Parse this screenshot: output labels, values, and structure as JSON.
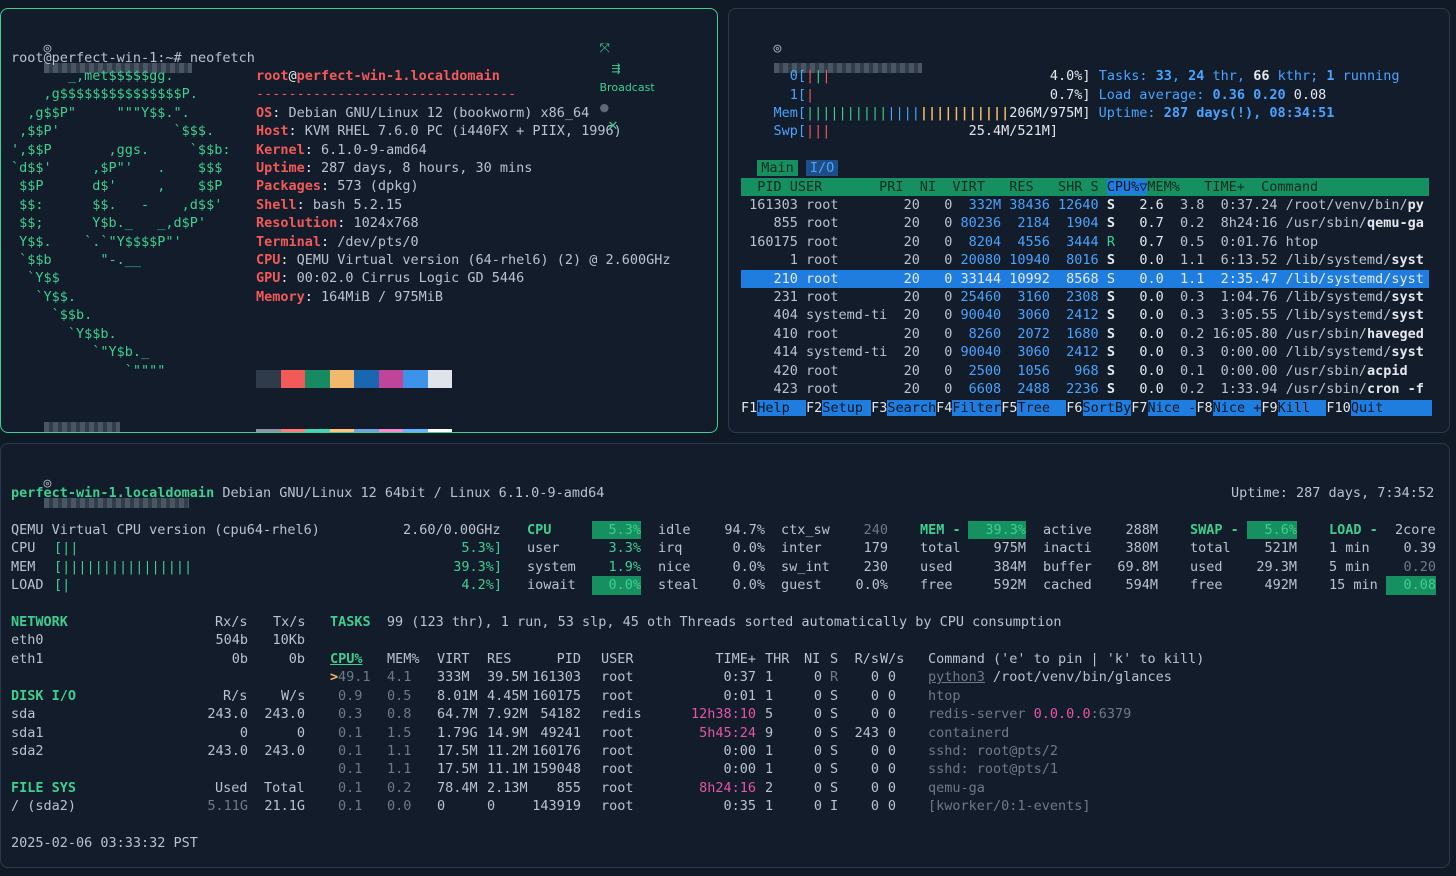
{
  "top_left": {
    "broadcast_label": "Broadcast",
    "prompt": "root@perfect-win-1:~# ",
    "command": "neofetch",
    "logo_lines": [
      "       _,met$$$$$gg.",
      "    ,g$$$$$$$$$$$$$$$P.",
      "  ,g$$P\"     \"\"\"Y$$.\".",
      " ,$$P'              `$$$.",
      "',$$P       ,ggs.     `$$b:",
      "`d$$'     ,$P\"'   .    $$$",
      " $$P      d$'     ,    $$P",
      " $$:      $$.   -    ,d$$'",
      " $$;      Y$b._   _,d$P'",
      " Y$$.    `.`\"Y$$$$P\"'",
      " `$$b      \"-.__",
      "  `Y$$",
      "   `Y$$.",
      "     `$$b.",
      "       `Y$$b.",
      "          `\"Y$b._",
      "              `\"\"\"\""
    ],
    "title_user": "root",
    "title_at": "@",
    "title_host": "perfect-win-1.localdomain",
    "separator": "--------------------------------",
    "info": [
      {
        "key": "OS",
        "value": "Debian GNU/Linux 12 (bookworm) x86_64"
      },
      {
        "key": "Host",
        "value": "KVM RHEL 7.6.0 PC (i440FX + PIIX, 1996)"
      },
      {
        "key": "Kernel",
        "value": "6.1.0-9-amd64"
      },
      {
        "key": "Uptime",
        "value": "287 days, 8 hours, 30 mins"
      },
      {
        "key": "Packages",
        "value": "573 (dpkg)"
      },
      {
        "key": "Shell",
        "value": "bash 5.2.15"
      },
      {
        "key": "Resolution",
        "value": "1024x768"
      },
      {
        "key": "Terminal",
        "value": "/dev/pts/0"
      },
      {
        "key": "CPU",
        "value": "QEMU Virtual version (64-rhel6) (2) @ 2.600GHz"
      },
      {
        "key": "GPU",
        "value": "00:02.0 Cirrus Logic GD 5446"
      },
      {
        "key": "Memory",
        "value": "164MiB / 975MiB"
      }
    ],
    "palette_row1": [
      "#2f3a4b",
      "#f25a5a",
      "#178a62",
      "#f2b96c",
      "#1a66b0",
      "#c0449a",
      "#3d93ea",
      "#dfe4ea"
    ],
    "palette_row2": [
      "#8a95a3",
      "#ff7b7b",
      "#45d6b5",
      "#ffc57f",
      "#6fa4d8",
      "#ff86c8",
      "#66b3ff",
      "#ffffff"
    ],
    "prompt2_tail": ":~# "
  },
  "top_right": {
    "cpu0_label": "0[",
    "cpu0_val": "4.0%]",
    "cpu1_label": "1[",
    "cpu1_val": "0.7%]",
    "mem_label": "Mem[",
    "mem_val": "206M/975M]",
    "swp_label": "Swp[",
    "swp_val": "25.4M/521M]",
    "tasks_label": "Tasks: ",
    "tasks_n": "33",
    "thr_n": "24",
    "thr_label": " thr, ",
    "kthr_n": "66",
    "kthr_label": " kthr; ",
    "running_n": "1",
    "running_label": " running",
    "load_label": "Load average: ",
    "load1": "0.36",
    "load5": "0.20",
    "load15": "0.08",
    "uptime_label": "Uptime: ",
    "uptime_val": "287 days(!), 08:34:51",
    "tab_main": "Main",
    "tab_io": "I/O",
    "header_left": "  PID USER       PRI  NI  VIRT   RES   SHR S ",
    "header_sort": "CPU%▽",
    "header_right": "MEM%   TIME+  Command",
    "rows": [
      {
        "pid": "161303",
        "user": "root",
        "pri": "20",
        "ni": "0",
        "virt": "332M",
        "res": "38436",
        "shr": "12640",
        "s": "S",
        "cpu": "2.6",
        "mem": "3.8",
        "time": "0:37.24",
        "cmd_dim": "/root/venv/bin/",
        "cmd_hl": "py"
      },
      {
        "pid": "855",
        "user": "root",
        "pri": "20",
        "ni": "0",
        "virt": "80236",
        "res": "2184",
        "shr": "1904",
        "s": "S",
        "cpu": "0.7",
        "mem": "0.2",
        "time": "8h24:16",
        "cmd_dim": "/usr/sbin/",
        "cmd_hl": "qemu-ga"
      },
      {
        "pid": "160175",
        "user": "root",
        "pri": "20",
        "ni": "0",
        "virt": "8204",
        "res": "4556",
        "shr": "3444",
        "s": "R",
        "cpu": "0.7",
        "mem": "0.5",
        "time": "0:01.76",
        "cmd_dim": "",
        "cmd_hl": "htop"
      },
      {
        "pid": "1",
        "user": "root",
        "pri": "20",
        "ni": "0",
        "virt": "20080",
        "res": "10940",
        "shr": "8016",
        "s": "S",
        "cpu": "0.0",
        "mem": "1.1",
        "time": "6:13.52",
        "cmd_dim": "/lib/systemd/",
        "cmd_hl": "syst"
      },
      {
        "pid": "210",
        "user": "root",
        "pri": "20",
        "ni": "0",
        "virt": "33144",
        "res": "10992",
        "shr": "8568",
        "s": "S",
        "cpu": "0.0",
        "mem": "1.1",
        "time": "2:35.47",
        "cmd_dim": "/lib/systemd/",
        "cmd_hl": "syst"
      },
      {
        "pid": "231",
        "user": "root",
        "pri": "20",
        "ni": "0",
        "virt": "25460",
        "res": "3160",
        "shr": "2308",
        "s": "S",
        "cpu": "0.0",
        "mem": "0.3",
        "time": "1:04.76",
        "cmd_dim": "/lib/systemd/",
        "cmd_hl": "syst"
      },
      {
        "pid": "404",
        "user": "systemd-ti",
        "pri": "20",
        "ni": "0",
        "virt": "90040",
        "res": "3060",
        "shr": "2412",
        "s": "S",
        "cpu": "0.0",
        "mem": "0.3",
        "time": "3:05.55",
        "cmd_dim": "/lib/systemd/",
        "cmd_hl": "syst"
      },
      {
        "pid": "410",
        "user": "root",
        "pri": "20",
        "ni": "0",
        "virt": "8260",
        "res": "2072",
        "shr": "1680",
        "s": "S",
        "cpu": "0.0",
        "mem": "0.2",
        "time": "16:05.80",
        "cmd_dim": "/usr/sbin/",
        "cmd_hl": "haveged"
      },
      {
        "pid": "414",
        "user": "systemd-ti",
        "pri": "20",
        "ni": "0",
        "virt": "90040",
        "res": "3060",
        "shr": "2412",
        "s": "S",
        "cpu": "0.0",
        "mem": "0.3",
        "time": "0:00.00",
        "cmd_dim": "/lib/systemd/",
        "cmd_hl": "syst"
      },
      {
        "pid": "420",
        "user": "root",
        "pri": "20",
        "ni": "0",
        "virt": "2500",
        "res": "1056",
        "shr": "968",
        "s": "S",
        "cpu": "0.0",
        "mem": "0.1",
        "time": "0:00.00",
        "cmd_dim": "/usr/sbin/",
        "cmd_hl": "acpid"
      },
      {
        "pid": "423",
        "user": "root",
        "pri": "20",
        "ni": "0",
        "virt": "6608",
        "res": "2488",
        "shr": "2236",
        "s": "S",
        "cpu": "0.0",
        "mem": "0.2",
        "time": "1:33.94",
        "cmd_dim": "/usr/sbin/",
        "cmd_hl": "cron -f"
      }
    ],
    "fkeys": [
      {
        "key": "F1",
        "label": "Help  "
      },
      {
        "key": "F2",
        "label": "Setup "
      },
      {
        "key": "F3",
        "label": "Search"
      },
      {
        "key": "F4",
        "label": "Filter"
      },
      {
        "key": "F5",
        "label": "Tree  "
      },
      {
        "key": "F6",
        "label": "SortBy"
      },
      {
        "key": "F7",
        "label": "Nice -"
      },
      {
        "key": "F8",
        "label": "Nice +"
      },
      {
        "key": "F9",
        "label": "Kill  "
      },
      {
        "key": "F10",
        "label": "Quit      "
      }
    ]
  },
  "bottom": {
    "hostname": "perfect-win-1.localdomain",
    "system": " Debian GNU/Linux 12 64bit / Linux 6.1.0-9-amd64",
    "uptime": "Uptime: 287 days, 7:34:52",
    "cpu_model": "QEMU Virtual CPU version (cpu64-rhel6)",
    "cpu_freq": "2.60/0.00GHz",
    "quick": [
      {
        "label": "CPU ",
        "bar": "[||",
        "val": "5.3%]"
      },
      {
        "label": "MEM ",
        "bar": "[||||||||||||||||",
        "val": "39.3%]"
      },
      {
        "label": "LOAD",
        "bar": "[|",
        "val": "4.2%]"
      }
    ],
    "cpu_title": "CPU",
    "cpu_total": "5.3%",
    "cpu_stats": [
      {
        "k": "user",
        "v": "3.3%"
      },
      {
        "k": "system",
        "v": "1.9%"
      },
      {
        "k": "iowait",
        "v": "0.0%"
      }
    ],
    "cpu_stats2": [
      {
        "k": "idle",
        "v": "94.7%"
      },
      {
        "k": "irq",
        "v": "0.0%"
      },
      {
        "k": "nice",
        "v": "0.0%"
      },
      {
        "k": "steal",
        "v": "0.0%"
      }
    ],
    "cpu_stats3": [
      {
        "k": "ctx_sw",
        "v": "240"
      },
      {
        "k": "inter",
        "v": "179"
      },
      {
        "k": "sw_int",
        "v": "230"
      },
      {
        "k": "guest",
        "v": "0.0%"
      }
    ],
    "mem_title": "MEM -",
    "mem_total": "39.3%",
    "mem_stats": [
      {
        "k": "total",
        "v": "975M"
      },
      {
        "k": "used",
        "v": "384M"
      },
      {
        "k": "free",
        "v": "592M"
      }
    ],
    "mem_stats2": [
      {
        "k": "active",
        "v": "288M"
      },
      {
        "k": "inacti",
        "v": "380M"
      },
      {
        "k": "buffer",
        "v": "69.8M"
      },
      {
        "k": "cached",
        "v": "594M"
      }
    ],
    "swap_title": "SWAP -",
    "swap_total": "5.6%",
    "swap_stats": [
      {
        "k": "total",
        "v": "521M"
      },
      {
        "k": "used",
        "v": "29.3M"
      },
      {
        "k": "free",
        "v": "492M"
      }
    ],
    "load_title": "LOAD -",
    "load_cores": "2core",
    "load_stats": [
      {
        "k": "1 min",
        "v": "0.39"
      },
      {
        "k": "5 min",
        "v": "0.20"
      },
      {
        "k": "15 min",
        "v": "0.08"
      }
    ],
    "network_title": "NETWORK",
    "net_rx": "Rx/s",
    "net_tx": "Tx/s",
    "network": [
      {
        "name": "eth0",
        "rx": "504b",
        "tx": "10Kb"
      },
      {
        "name": "eth1",
        "rx": "0b",
        "tx": "0b"
      }
    ],
    "disk_title": "DISK I/O",
    "disk_r": "R/s",
    "disk_w": "W/s",
    "disks": [
      {
        "name": "sda",
        "r": "243.0",
        "w": "243.0"
      },
      {
        "name": "sda1",
        "r": "0",
        "w": "0"
      },
      {
        "name": "sda2",
        "r": "243.0",
        "w": "243.0"
      }
    ],
    "fs_title": "FILE SYS",
    "fs_used": "Used",
    "fs_total": "Total",
    "fs": [
      {
        "name": "/ (sda2)",
        "used": "5.11G",
        "total": "21.1G"
      }
    ],
    "tasks_title": "TASKS",
    "tasks_text": "99 (123 thr), 1 run, 53 slp, 45 oth Threads sorted automatically by CPU consumption",
    "proc_header": {
      "cpu": "CPU%",
      "mem": "MEM%",
      "virt": "VIRT",
      "res": "RES",
      "pid": "PID",
      "user": "USER",
      "time": "TIME+",
      "thr": "THR",
      "ni": "NI",
      "s": "S",
      "rs": "R/s",
      "ws": "W/s",
      "cmd": "Command ('e' to pin | 'k' to kill)"
    },
    "procs": [
      {
        "mark": ">",
        "cpu": "49.1",
        "mem": "4.1",
        "virt": "333M",
        "res": "39.5M",
        "pid": "161303",
        "user": "root",
        "time": "0:37",
        "thr": "1",
        "ni": "0",
        "s": "R",
        "rs": "0",
        "ws": "0",
        "cmd1": "python3",
        "cmd2": " /root/venv/bin/glances"
      },
      {
        "mark": " ",
        "cpu": "0.9",
        "mem": "0.5",
        "virt": "8.01M",
        "res": "4.45M",
        "pid": "160175",
        "user": "root",
        "time": "0:01",
        "thr": "1",
        "ni": "0",
        "s": "S",
        "rs": "0",
        "ws": "0",
        "cmd1": "htop",
        "cmd2": ""
      },
      {
        "mark": " ",
        "cpu": "0.3",
        "mem": "0.8",
        "virt": "64.7M",
        "res": "7.92M",
        "pid": "54182",
        "user": "redis",
        "time": "12h38:10",
        "thr": "5",
        "ni": "0",
        "s": "S",
        "rs": "0",
        "ws": "0",
        "cmd1": "redis-server",
        "cmd2": " 0.0.0.0:6379"
      },
      {
        "mark": " ",
        "cpu": "0.1",
        "mem": "1.5",
        "virt": "1.79G",
        "res": "14.9M",
        "pid": "49241",
        "user": "root",
        "time": "5h45:24",
        "thr": "9",
        "ni": "0",
        "s": "S",
        "rs": "243",
        "ws": "0",
        "cmd1": "containerd",
        "cmd2": ""
      },
      {
        "mark": " ",
        "cpu": "0.1",
        "mem": "1.1",
        "virt": "17.5M",
        "res": "11.2M",
        "pid": "160176",
        "user": "root",
        "time": "0:00",
        "thr": "1",
        "ni": "0",
        "s": "S",
        "rs": "0",
        "ws": "0",
        "cmd1": "sshd: root@pts/2",
        "cmd2": ""
      },
      {
        "mark": " ",
        "cpu": "0.1",
        "mem": "1.1",
        "virt": "17.5M",
        "res": "11.1M",
        "pid": "159048",
        "user": "root",
        "time": "0:00",
        "thr": "1",
        "ni": "0",
        "s": "S",
        "rs": "0",
        "ws": "0",
        "cmd1": "sshd: root@pts/1",
        "cmd2": ""
      },
      {
        "mark": " ",
        "cpu": "0.1",
        "mem": "0.2",
        "virt": "78.4M",
        "res": "2.13M",
        "pid": "855",
        "user": "root",
        "time": "8h24:16",
        "thr": "2",
        "ni": "0",
        "s": "S",
        "rs": "0",
        "ws": "0",
        "cmd1": "qemu-ga",
        "cmd2": ""
      },
      {
        "mark": " ",
        "cpu": "0.1",
        "mem": "0.0",
        "virt": "0",
        "res": "0",
        "pid": "143919",
        "user": "root",
        "time": "0:35",
        "thr": "1",
        "ni": "0",
        "s": "I",
        "rs": "0",
        "ws": "0",
        "cmd1": "[kworker/0:1-events]",
        "cmd2": ""
      }
    ],
    "datetime": "2025-02-06 03:33:32 PST"
  }
}
